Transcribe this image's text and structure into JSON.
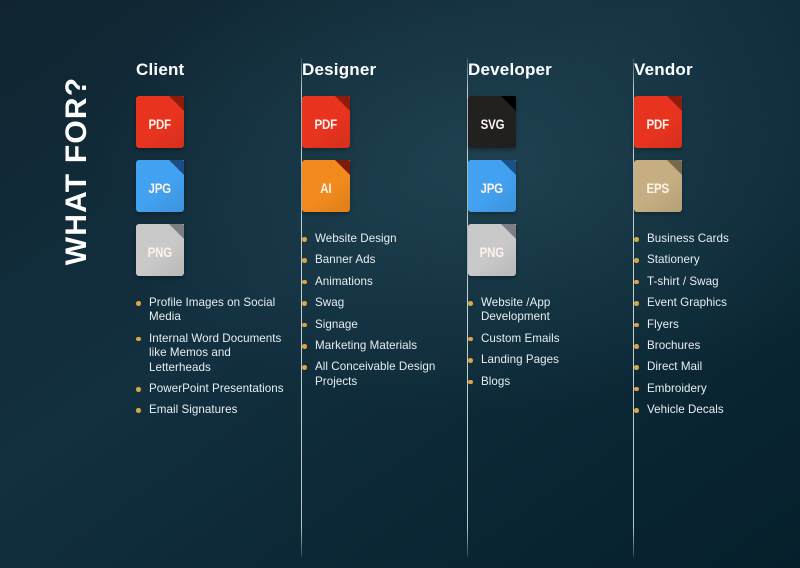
{
  "title": {
    "text": "WHAT FOR?",
    "color": "#ffffff"
  },
  "theme": {
    "background_dark": "#05202b",
    "background_mid": "#123040",
    "bullet_color": "#d9a441",
    "divider_color": "#e2ebee",
    "text_color": "#e8eef1"
  },
  "columns": [
    {
      "title": "Client",
      "icons": [
        {
          "label": "PDF",
          "kind": "file-icon-pdf",
          "body": "#e8341f",
          "fold": "#8f1b0d"
        },
        {
          "label": "JPG",
          "kind": "file-icon-jpg",
          "body": "#42a1f0",
          "fold": "#1a4f86"
        },
        {
          "label": "PNG",
          "kind": "file-icon-png",
          "body": "#c9c9c9",
          "fold": "#7c8086"
        }
      ],
      "items": [
        "Profile Images on Social Media",
        "Internal Word Documents like Memos and Letterheads",
        "PowerPoint Presentations",
        "Email Signatures"
      ]
    },
    {
      "title": "Designer",
      "icons": [
        {
          "label": "PDF",
          "kind": "file-icon-pdf",
          "body": "#e8341f",
          "fold": "#8f1b0d"
        },
        {
          "label": "AI",
          "kind": "file-icon-ai",
          "body": "#f28b1e",
          "fold": "#7d1a0c"
        }
      ],
      "items": [
        "Website Design",
        "Banner Ads",
        "Animations",
        "Swag",
        "Signage",
        "Marketing Materials",
        "All Conceivable Design Projects"
      ]
    },
    {
      "title": "Developer",
      "icons": [
        {
          "label": "SVG",
          "kind": "file-icon-svg",
          "body": "#22211f",
          "fold": "#000000"
        },
        {
          "label": "JPG",
          "kind": "file-icon-jpg",
          "body": "#42a1f0",
          "fold": "#1a4f86"
        },
        {
          "label": "PNG",
          "kind": "file-icon-png",
          "body": "#c9c9c9",
          "fold": "#7c8086"
        }
      ],
      "items": [
        "Website /App Development",
        "Custom Emails",
        "Landing Pages",
        "Blogs"
      ]
    },
    {
      "title": "Vendor",
      "icons": [
        {
          "label": "PDF",
          "kind": "file-icon-pdf",
          "body": "#e8341f",
          "fold": "#8f1b0d"
        },
        {
          "label": "EPS",
          "kind": "file-icon-eps",
          "body": "#c6ae82",
          "fold": "#7a6a4d"
        }
      ],
      "items": [
        "Business Cards",
        "Stationery",
        "T-shirt / Swag",
        "Event Graphics",
        "Flyers",
        "Brochures",
        "Direct Mail",
        "Embroidery",
        "Vehicle Decals"
      ]
    }
  ]
}
